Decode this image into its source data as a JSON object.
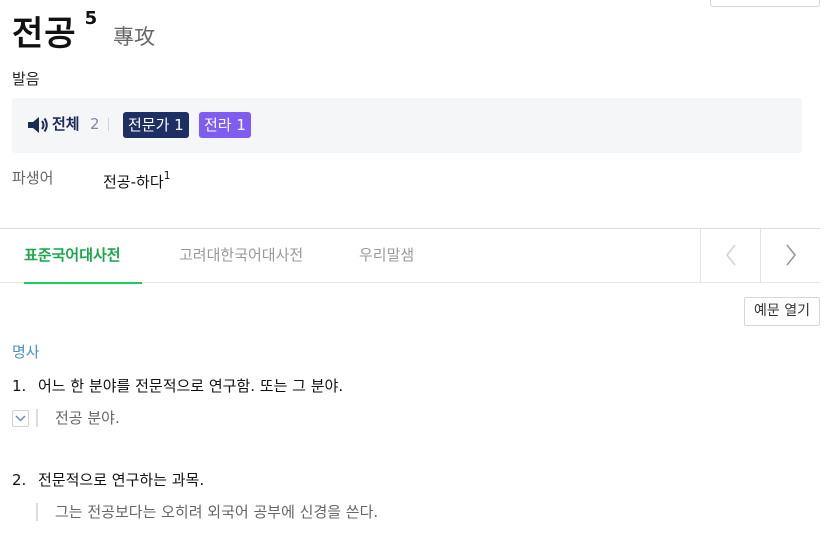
{
  "entry": {
    "headword": "전공",
    "homonym_number": "5",
    "hanja": "專攻"
  },
  "pronunciation": {
    "label": "발음",
    "all_label": "전체",
    "all_count": "2",
    "variants": [
      {
        "label": "전문가 1",
        "color": "#1d2f63"
      },
      {
        "label": "전라 1",
        "color": "#7f5cf2"
      }
    ]
  },
  "derivative": {
    "label": "파생어",
    "word": "전공-하다",
    "superscript": "1"
  },
  "tabs": [
    {
      "label": "표준국어대사전",
      "active": true
    },
    {
      "label": "고려대한국어대사전",
      "active": false
    },
    {
      "label": "우리말샘",
      "active": false
    }
  ],
  "example_toggle_label": "예문 열기",
  "part_of_speech": "명사",
  "senses": [
    {
      "number": "1.",
      "definition": "어느 한 분야를 전문적으로 연구함. 또는 그 분야.",
      "example": "전공 분야."
    },
    {
      "number": "2.",
      "definition": "전문적으로 연구하는 과목.",
      "example": "그는 전공보다는 오히려 외국어 공부에 신경을 쓴다."
    }
  ],
  "colors": {
    "accent_green": "#19ce60",
    "pos_blue": "#4a90c0",
    "navy": "#1b2b57"
  }
}
